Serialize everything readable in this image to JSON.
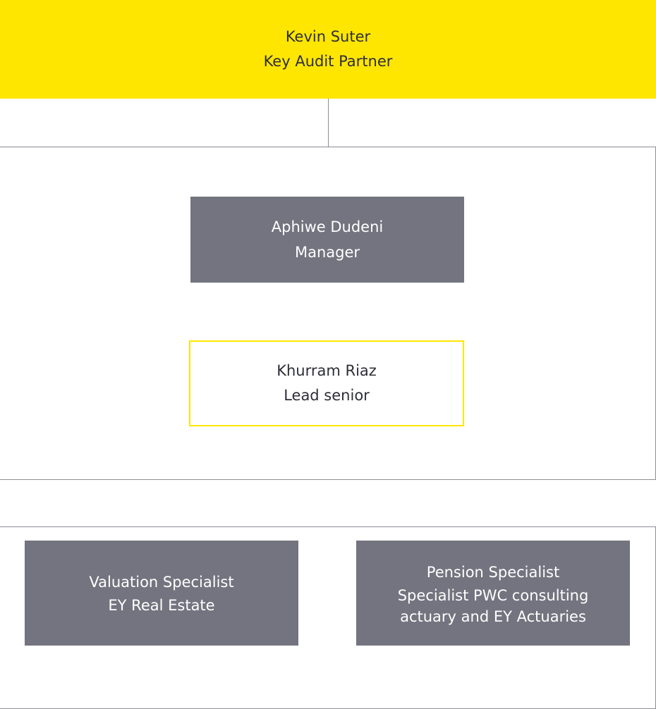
{
  "partner": {
    "name": "Kevin Suter",
    "role": "Key Audit Partner"
  },
  "core_team": [
    {
      "name": "Aphiwe Dudeni",
      "role": "Manager"
    },
    {
      "name": "Khurram Riaz",
      "role": "Lead senior"
    }
  ],
  "specialists": [
    {
      "name": "Valuation Specialist",
      "detail": "EY Real Estate"
    },
    {
      "name": "Pension Specialist",
      "detail": "Specialist PWC consulting actuary and EY Actuaries"
    }
  ],
  "colors": {
    "accent": "#ffe600",
    "box": "#747480",
    "border": "#8c8c94",
    "text": "#2e2e38"
  }
}
